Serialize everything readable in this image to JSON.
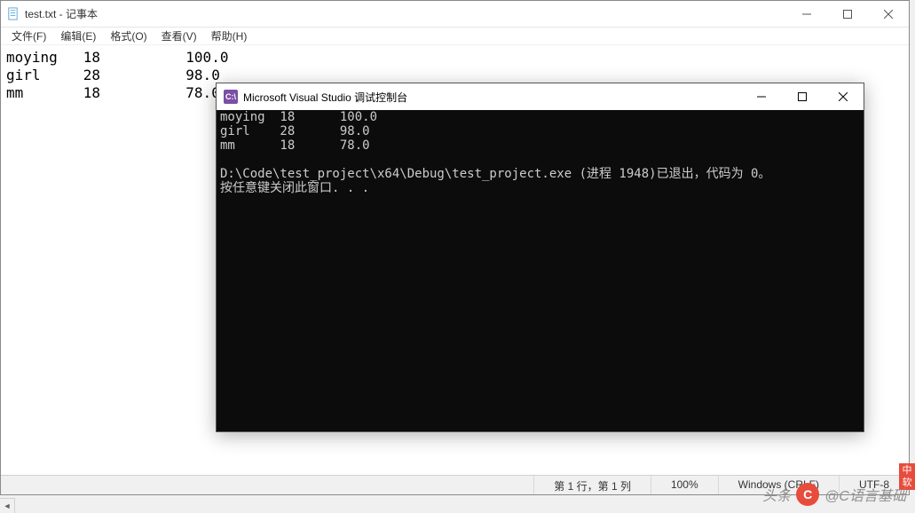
{
  "notepad": {
    "title": "test.txt - 记事本",
    "menu": {
      "file": "文件(F)",
      "edit": "编辑(E)",
      "format": "格式(O)",
      "view": "查看(V)",
      "help": "帮助(H)"
    },
    "content_lines": [
      "moying   18          100.0",
      "girl     28          98.0",
      "mm       18          78.0"
    ],
    "records": [
      {
        "name": "moying",
        "age": 18,
        "score": 100.0
      },
      {
        "name": "girl",
        "age": 28,
        "score": 98.0
      },
      {
        "name": "mm",
        "age": 18,
        "score": 78.0
      }
    ],
    "status": {
      "pos": "第 1 行，第 1 列",
      "zoom": "100%",
      "eol": "Windows (CRLF)",
      "encoding": "UTF-8"
    }
  },
  "console": {
    "title": "Microsoft Visual Studio 调试控制台",
    "icon_text": "C:\\",
    "output_lines": [
      "moying  18      100.0",
      "girl    28      98.0",
      "mm      18      78.0",
      "",
      "D:\\Code\\test_project\\x64\\Debug\\test_project.exe (进程 1948)已退出，代码为 0。",
      "按任意键关闭此窗口. . ."
    ],
    "records": [
      {
        "name": "moying",
        "age": 18,
        "score": 100.0
      },
      {
        "name": "girl",
        "age": 28,
        "score": 98.0
      },
      {
        "name": "mm",
        "age": 18,
        "score": 78.0
      }
    ],
    "exit_message": "D:\\Code\\test_project\\x64\\Debug\\test_project.exe (进程 1948)已退出，代码为 0。",
    "prompt": "按任意键关闭此窗口. . ."
  },
  "watermark": {
    "prefix": "头条",
    "account": "@C语言基础"
  },
  "ime": "中 软"
}
